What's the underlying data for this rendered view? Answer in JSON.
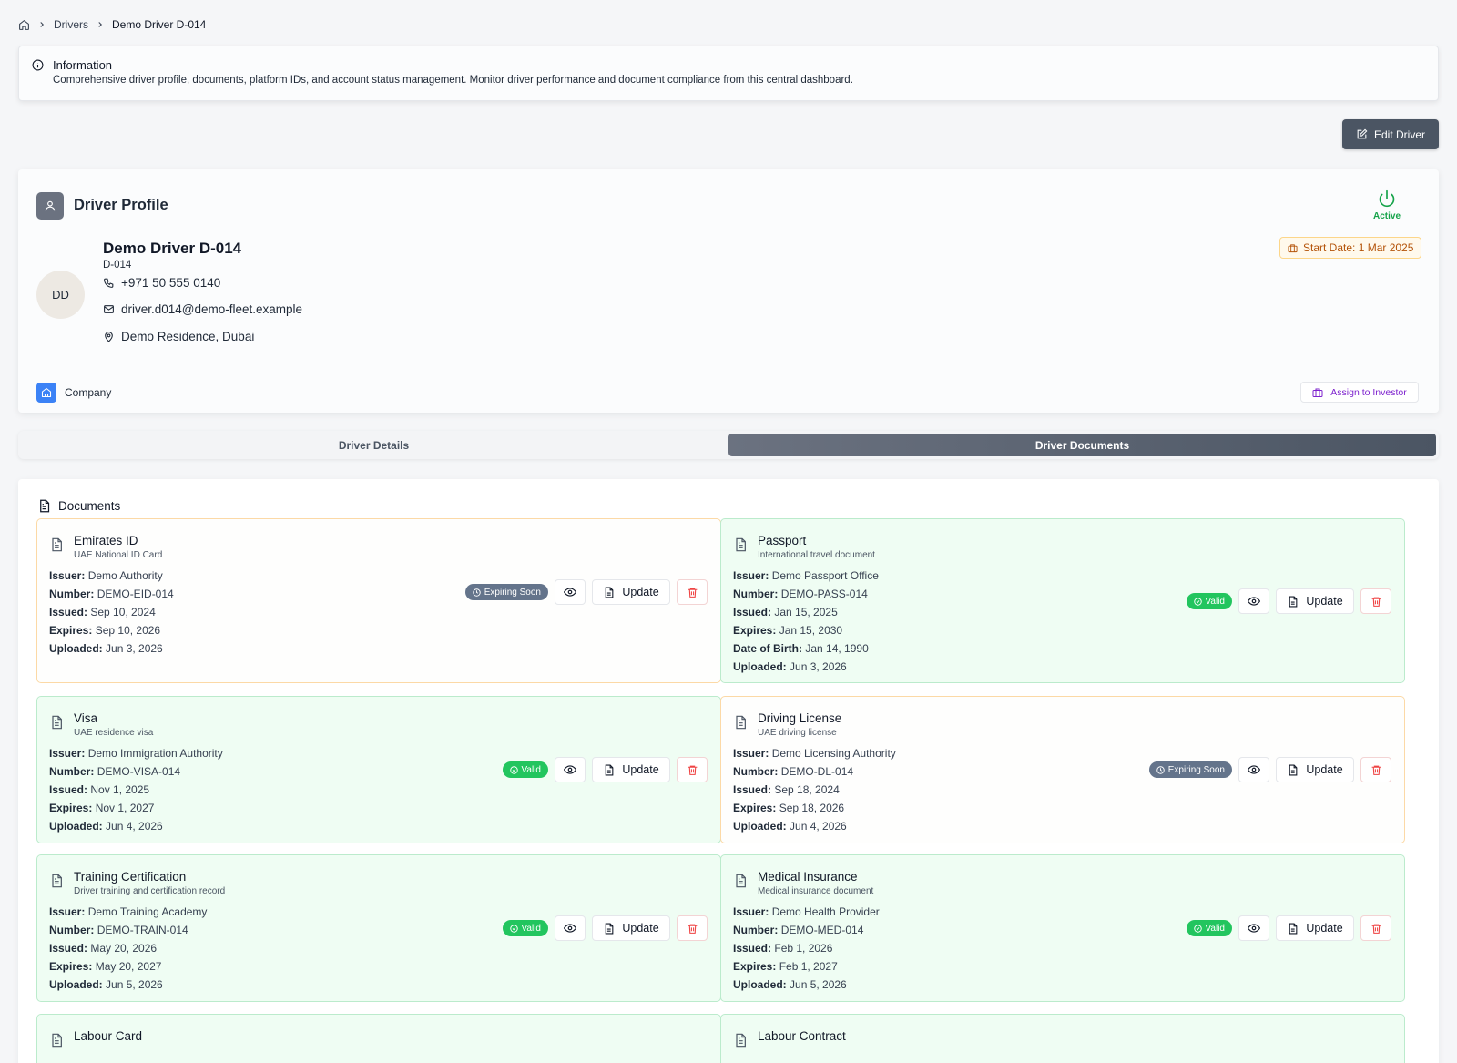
{
  "breadcrumb": {
    "item1": "Drivers",
    "item2": "Demo Driver D-014"
  },
  "info": {
    "title": "Information",
    "description": "Comprehensive driver profile, documents, platform IDs, and account status management. Monitor driver performance and document compliance from this central dashboard."
  },
  "toolbar": {
    "edit_label": "Edit Driver"
  },
  "profile": {
    "heading": "Driver Profile",
    "status": "Active",
    "start_date": "Start Date: 1 Mar 2025",
    "initials": "DD",
    "name": "Demo Driver D-014",
    "id": "D-014",
    "phone": "+971 50 555 0140",
    "email": "driver.d014@demo-fleet.example",
    "address": "Demo Residence, Dubai",
    "company_label": "Company",
    "assign_label": "Assign to Investor"
  },
  "tabs": {
    "details": "Driver Details",
    "documents": "Driver Documents"
  },
  "documents": {
    "heading": "Documents",
    "update_label": "Update",
    "items": [
      {
        "title": "Emirates ID",
        "subtitle": "UAE National ID Card",
        "status": "Expiring Soon",
        "fields": [
          {
            "label": "Issuer:",
            "value": "Demo Authority"
          },
          {
            "label": "Number:",
            "value": "DEMO-EID-014"
          },
          {
            "label": "Issued:",
            "value": "Sep 10, 2024"
          },
          {
            "label": "Expires:",
            "value": "Sep 10, 2026"
          },
          {
            "label": "Uploaded:",
            "value": "Jun 3, 2026"
          }
        ]
      },
      {
        "title": "Passport",
        "subtitle": "International travel document",
        "status": "Valid",
        "fields": [
          {
            "label": "Issuer:",
            "value": "Demo Passport Office"
          },
          {
            "label": "Number:",
            "value": "DEMO-PASS-014"
          },
          {
            "label": "Issued:",
            "value": "Jan 15, 2025"
          },
          {
            "label": "Expires:",
            "value": "Jan 15, 2030"
          },
          {
            "label": "Date of Birth:",
            "value": "Jan 14, 1990"
          },
          {
            "label": "Uploaded:",
            "value": "Jun 3, 2026"
          }
        ]
      },
      {
        "title": "Visa",
        "subtitle": "UAE residence visa",
        "status": "Valid",
        "fields": [
          {
            "label": "Issuer:",
            "value": "Demo Immigration Authority"
          },
          {
            "label": "Number:",
            "value": "DEMO-VISA-014"
          },
          {
            "label": "Issued:",
            "value": "Nov 1, 2025"
          },
          {
            "label": "Expires:",
            "value": "Nov 1, 2027"
          },
          {
            "label": "Uploaded:",
            "value": "Jun 4, 2026"
          }
        ]
      },
      {
        "title": "Driving License",
        "subtitle": "UAE driving license",
        "status": "Expiring Soon",
        "fields": [
          {
            "label": "Issuer:",
            "value": "Demo Licensing Authority"
          },
          {
            "label": "Number:",
            "value": "DEMO-DL-014"
          },
          {
            "label": "Issued:",
            "value": "Sep 18, 2024"
          },
          {
            "label": "Expires:",
            "value": "Sep 18, 2026"
          },
          {
            "label": "Uploaded:",
            "value": "Jun 4, 2026"
          }
        ]
      },
      {
        "title": "Training Certification",
        "subtitle": "Driver training and certification record",
        "status": "Valid",
        "fields": [
          {
            "label": "Issuer:",
            "value": "Demo Training Academy"
          },
          {
            "label": "Number:",
            "value": "DEMO-TRAIN-014"
          },
          {
            "label": "Issued:",
            "value": "May 20, 2026"
          },
          {
            "label": "Expires:",
            "value": "May 20, 2027"
          },
          {
            "label": "Uploaded:",
            "value": "Jun 5, 2026"
          }
        ]
      },
      {
        "title": "Medical Insurance",
        "subtitle": "Medical insurance document",
        "status": "Valid",
        "fields": [
          {
            "label": "Issuer:",
            "value": "Demo Health Provider"
          },
          {
            "label": "Number:",
            "value": "DEMO-MED-014"
          },
          {
            "label": "Issued:",
            "value": "Feb 1, 2026"
          },
          {
            "label": "Expires:",
            "value": "Feb 1, 2027"
          },
          {
            "label": "Uploaded:",
            "value": "Jun 5, 2026"
          }
        ]
      },
      {
        "title": "Labour Card"
      },
      {
        "title": "Labour Contract"
      }
    ]
  }
}
